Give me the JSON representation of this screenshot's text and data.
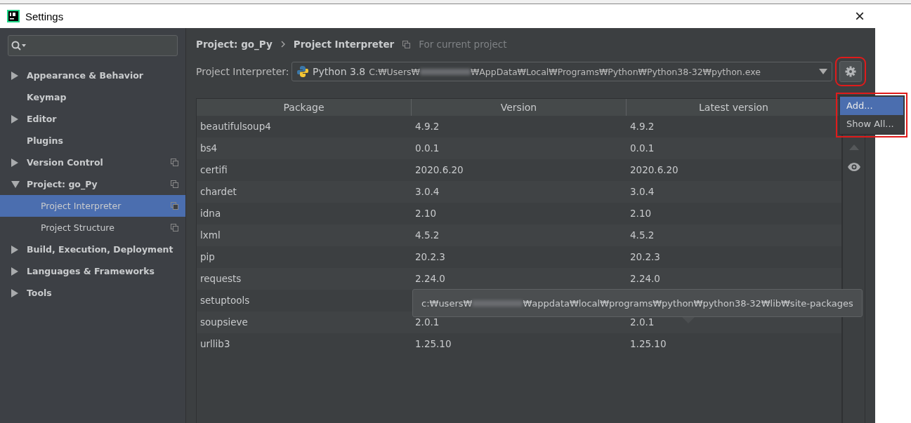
{
  "window": {
    "title": "Settings",
    "close": "×"
  },
  "sidebar": {
    "items": [
      {
        "label": "Appearance & Behavior",
        "kind": "folder",
        "expanded": false,
        "selected": false,
        "project_scoped": false
      },
      {
        "label": "Keymap",
        "kind": "page",
        "selected": false,
        "project_scoped": false
      },
      {
        "label": "Editor",
        "kind": "folder",
        "expanded": false,
        "selected": false,
        "project_scoped": false
      },
      {
        "label": "Plugins",
        "kind": "page",
        "selected": false,
        "project_scoped": false
      },
      {
        "label": "Version Control",
        "kind": "folder",
        "expanded": false,
        "selected": false,
        "project_scoped": true
      },
      {
        "label": "Project: go_Py",
        "kind": "folder",
        "expanded": true,
        "selected": false,
        "project_scoped": true,
        "children": [
          {
            "label": "Project Interpreter",
            "kind": "page",
            "selected": true,
            "project_scoped": true
          },
          {
            "label": "Project Structure",
            "kind": "page",
            "selected": false,
            "project_scoped": true
          }
        ]
      },
      {
        "label": "Build, Execution, Deployment",
        "kind": "folder",
        "expanded": false,
        "selected": false,
        "project_scoped": false
      },
      {
        "label": "Languages & Frameworks",
        "kind": "folder",
        "expanded": false,
        "selected": false,
        "project_scoped": false
      },
      {
        "label": "Tools",
        "kind": "folder",
        "expanded": false,
        "selected": false,
        "project_scoped": false
      }
    ]
  },
  "breadcrumb": [
    "Project: go_Py",
    "Project Interpreter"
  ],
  "scope_note": "For current project",
  "interpreter": {
    "label": "Project Interpreter:",
    "name": "Python 3.8",
    "path_start": "C:₩Users₩",
    "path_end": "₩AppData₩Local₩Programs₩Python₩Python38-32₩python.exe"
  },
  "gear_menu": [
    {
      "label": "Add...",
      "selected": true
    },
    {
      "label": "Show All...",
      "selected": false
    }
  ],
  "table": {
    "columns": [
      "Package",
      "Version",
      "Latest version"
    ],
    "rows": [
      [
        "beautifulsoup4",
        "4.9.2",
        "4.9.2"
      ],
      [
        "bs4",
        "0.0.1",
        "0.0.1"
      ],
      [
        "certifi",
        "2020.6.20",
        "2020.6.20"
      ],
      [
        "chardet",
        "3.0.4",
        "3.0.4"
      ],
      [
        "idna",
        "2.10",
        "2.10"
      ],
      [
        "lxml",
        "4.5.2",
        "4.5.2"
      ],
      [
        "pip",
        "20.2.3",
        "20.2.3"
      ],
      [
        "requests",
        "2.24.0",
        "2.24.0"
      ],
      [
        "setuptools",
        "",
        ""
      ],
      [
        "soupsieve",
        "2.0.1",
        "2.0.1"
      ],
      [
        "urllib3",
        "1.25.10",
        "1.25.10"
      ]
    ]
  },
  "tooltip": {
    "path_start": "c:₩users₩",
    "path_end": "₩appdata₩local₩programs₩python₩python38-32₩lib₩site-packages"
  }
}
